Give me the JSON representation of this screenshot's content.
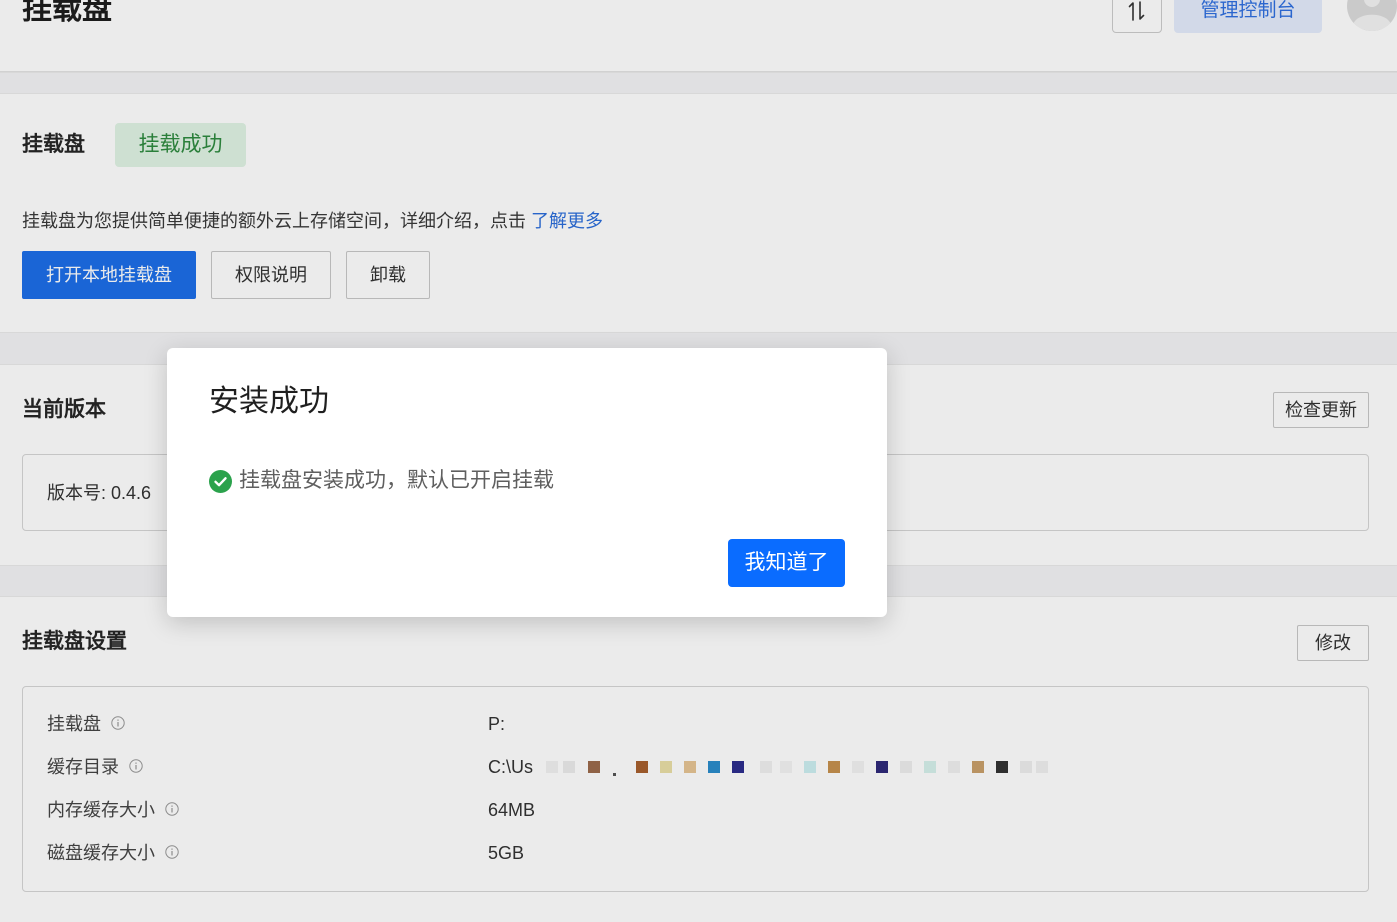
{
  "header": {
    "title": "挂载盘",
    "console_button": "管理控制台",
    "sort_icon": "sort-icon",
    "avatar_icon": "user-avatar-icon"
  },
  "mount_section": {
    "title": "挂载盘",
    "status_badge": "挂载成功",
    "description": "挂载盘为您提供简单便捷的额外云上存储空间，详细介绍，点击",
    "learn_more_link": "了解更多",
    "open_local_button": "打开本地挂载盘",
    "permissions_button": "权限说明",
    "uninstall_button": "卸载"
  },
  "version_section": {
    "title": "当前版本",
    "check_update_button": "检查更新",
    "version_text": "版本号: 0.4.6"
  },
  "settings_section": {
    "title": "挂载盘设置",
    "edit_button": "修改",
    "info_icon": "info-icon",
    "rows": [
      {
        "label": "挂载盘",
        "value": "P:"
      },
      {
        "label": "缓存目录",
        "value": "C:\\Us"
      },
      {
        "label": "内存缓存大小",
        "value": "64MB"
      },
      {
        "label": "磁盘缓存大小",
        "value": "5GB"
      }
    ]
  },
  "modal": {
    "title": "安装成功",
    "status_icon": "check-circle-icon",
    "message": "挂载盘安装成功，默认已开启挂载",
    "confirm_button": "我知道了"
  },
  "colors": {
    "primary": "#0a6cff",
    "success": "#2ba24c",
    "link": "#2b6ddb",
    "badge_bg": "#e0f3e4",
    "badge_text": "#2e8a3f"
  }
}
